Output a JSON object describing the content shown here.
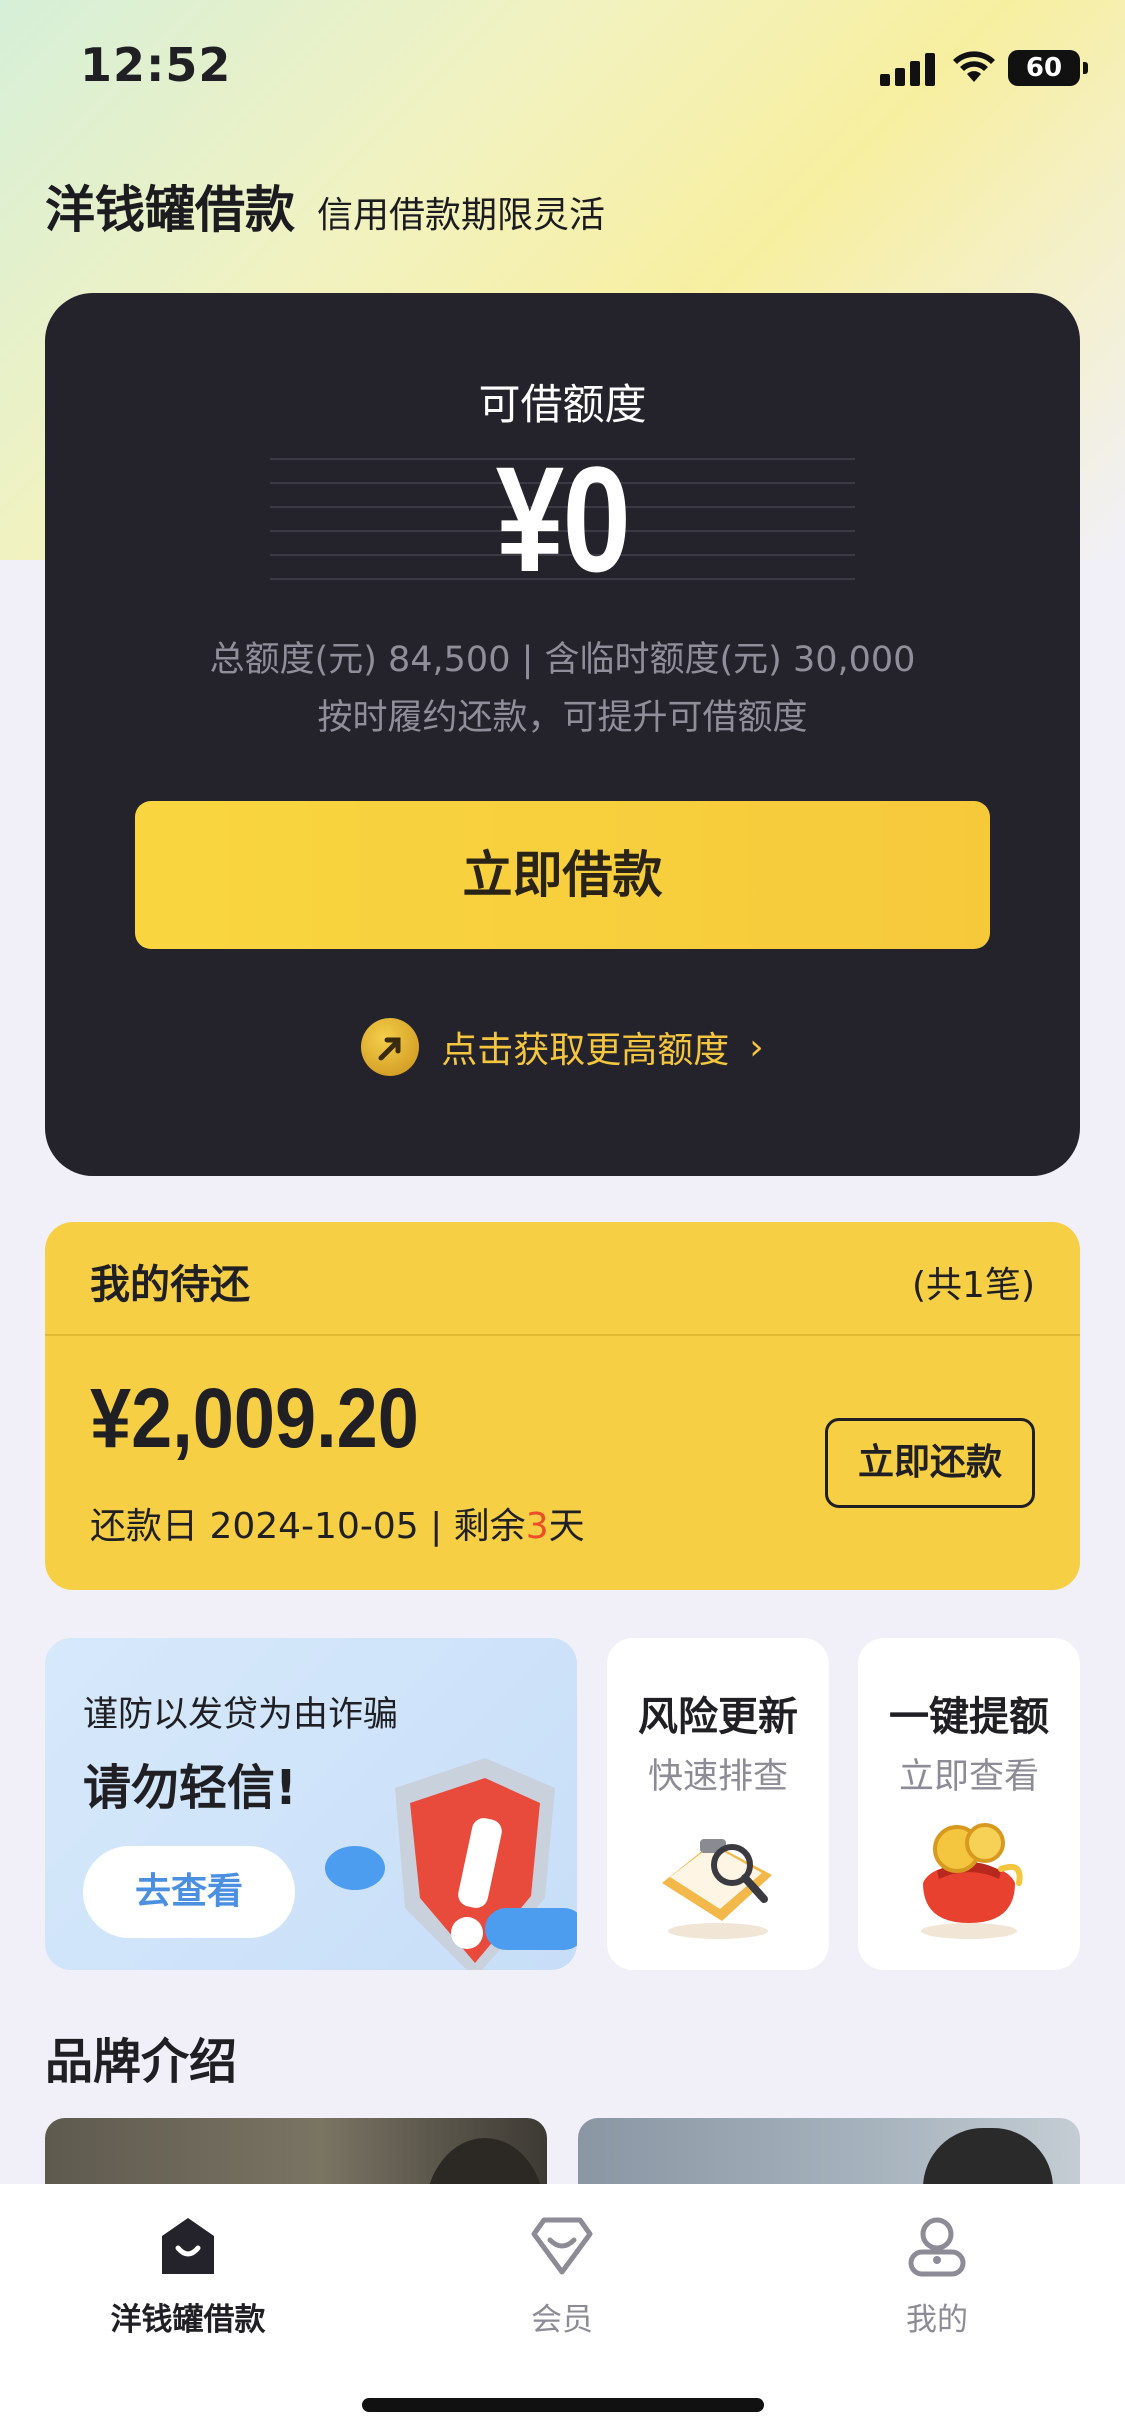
{
  "status_bar": {
    "time": "12:52",
    "battery": "60"
  },
  "header": {
    "title": "洋钱罐借款",
    "subtitle": "信用借款期限灵活"
  },
  "credit": {
    "label": "可借额度",
    "amount": "¥0",
    "total_line": "总额度(元) 84,500 | 含临时额度(元) 30,000",
    "hint": "按时履约还款，可提升可借额度",
    "borrow_button": "立即借款",
    "more_quota": "点击获取更高额度"
  },
  "repayment": {
    "title": "我的待还",
    "count": "(共1笔)",
    "amount": "¥2,009.20",
    "date_prefix": "还款日 2024-10-05 | 剩余",
    "days_left": "3",
    "days_suffix": "天",
    "button": "立即还款"
  },
  "promo": {
    "fraud_line1": "谨防以发贷为由诈骗",
    "fraud_line2": "请勿轻信!",
    "fraud_button": "去查看",
    "risk_title": "风险更新",
    "risk_sub": "快速排查",
    "raise_title": "一键提额",
    "raise_sub": "立即查看"
  },
  "brand": {
    "title": "品牌介绍"
  },
  "tabs": [
    {
      "label": "洋钱罐借款",
      "icon": "home-icon",
      "active": true
    },
    {
      "label": "会员",
      "icon": "member-icon",
      "active": false
    },
    {
      "label": "我的",
      "icon": "profile-icon",
      "active": false
    }
  ],
  "colors": {
    "accent": "#f6cf45",
    "dark_card": "#24232b",
    "highlight": "#f04b2a"
  }
}
